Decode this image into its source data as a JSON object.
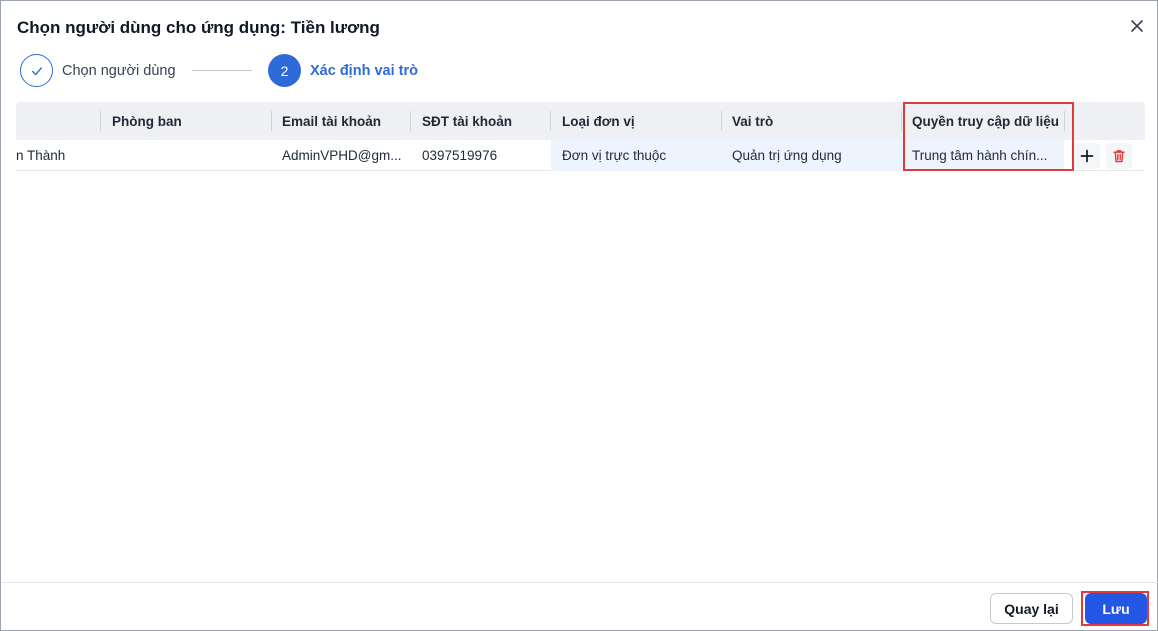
{
  "dialog": {
    "title": "Chọn người dùng cho ứng dụng: Tiền lương"
  },
  "stepper": {
    "steps": [
      {
        "index": "1",
        "label": "Chọn người dùng",
        "state": "completed"
      },
      {
        "index": "2",
        "label": "Xác định vai trò",
        "state": "active"
      }
    ]
  },
  "table": {
    "columns": [
      "",
      "Phòng ban",
      "Email tài khoản",
      "SĐT tài khoản",
      "Loại đơn vị",
      "Vai trò",
      "Quyền truy cập dữ liệu"
    ],
    "rows": [
      {
        "name": "n Thành",
        "department": "",
        "email": "AdminVPHD@gm...",
        "phone": "0397519976",
        "unit_type": "Đơn vị trực thuộc",
        "role": "Quản trị ứng dụng",
        "data_access": "Trung tâm hành chín..."
      }
    ]
  },
  "footer": {
    "back_label": "Quay lại",
    "save_label": "Lưu"
  },
  "colors": {
    "primary": "#2f6bd8",
    "save_button": "#2456e6",
    "highlight": "#e03a3a",
    "delete_icon": "#e03a3a"
  }
}
